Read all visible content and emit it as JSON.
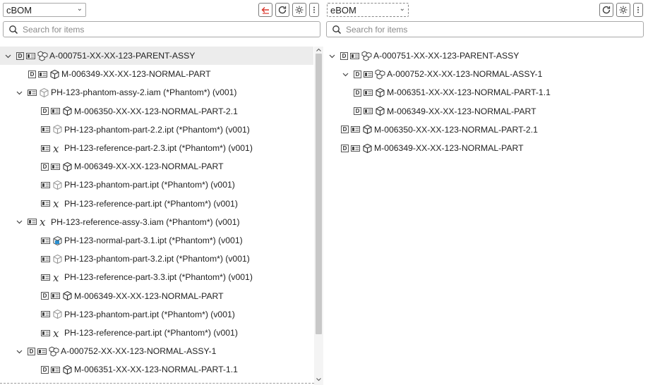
{
  "left": {
    "view_select": "cBOM",
    "search_placeholder": "Search for items",
    "toolbar": [
      "back-arrow-icon",
      "refresh-icon",
      "settings-icon",
      "more-icon"
    ],
    "rows": [
      {
        "label": "A-000751-XX-XX-123-PARENT-ASSY",
        "expanded": true,
        "d": true,
        "icon": "assembly",
        "selected": true
      },
      {
        "label": "M-006349-XX-XX-123-NORMAL-PART",
        "d": true,
        "icon": "part"
      },
      {
        "label": "PH-123-phantom-assy-2.iam (*Phantom*) (v001)",
        "expanded": true,
        "d": false,
        "icon": "phantom"
      },
      {
        "label": "M-006350-XX-XX-123-NORMAL-PART-2.1",
        "d": true,
        "icon": "part"
      },
      {
        "label": "PH-123-phantom-part-2.2.ipt (*Phantom*) (v001)",
        "d": false,
        "icon": "phantom"
      },
      {
        "label": "PH-123-reference-part-2.3.ipt (*Phantom*) (v001)",
        "d": false,
        "icon": "reference"
      },
      {
        "label": "M-006349-XX-XX-123-NORMAL-PART",
        "d": true,
        "icon": "part"
      },
      {
        "label": "PH-123-phantom-part.ipt (*Phantom*) (v001)",
        "d": false,
        "icon": "phantom"
      },
      {
        "label": "PH-123-reference-part.ipt (*Phantom*) (v001)",
        "d": false,
        "icon": "reference"
      },
      {
        "label": "PH-123-reference-assy-3.iam (*Phantom*) (v001)",
        "expanded": true,
        "d": false,
        "icon": "reference"
      },
      {
        "label": "PH-123-normal-part-3.1.ipt (*Phantom*) (v001)",
        "d": false,
        "icon": "normal-phantom"
      },
      {
        "label": "PH-123-phantom-part-3.2.ipt (*Phantom*) (v001)",
        "d": false,
        "icon": "phantom"
      },
      {
        "label": "PH-123-reference-part-3.3.ipt (*Phantom*) (v001)",
        "d": false,
        "icon": "reference"
      },
      {
        "label": "M-006349-XX-XX-123-NORMAL-PART",
        "d": true,
        "icon": "part"
      },
      {
        "label": "PH-123-phantom-part.ipt (*Phantom*) (v001)",
        "d": false,
        "icon": "phantom"
      },
      {
        "label": "PH-123-reference-part.ipt (*Phantom*) (v001)",
        "d": false,
        "icon": "reference"
      },
      {
        "label": "A-000752-XX-XX-123-NORMAL-ASSY-1",
        "expanded": true,
        "d": true,
        "icon": "assembly"
      },
      {
        "label": "M-006351-XX-XX-123-NORMAL-PART-1.1",
        "d": true,
        "icon": "part"
      }
    ]
  },
  "right": {
    "view_select": "eBOM",
    "search_placeholder": "Search for items",
    "toolbar": [
      "refresh-icon",
      "settings-icon",
      "more-icon"
    ],
    "rows": [
      {
        "label": "A-000751-XX-XX-123-PARENT-ASSY",
        "expanded": true,
        "d": true,
        "icon": "assembly"
      },
      {
        "label": "A-000752-XX-XX-123-NORMAL-ASSY-1",
        "expanded": true,
        "d": true,
        "icon": "assembly"
      },
      {
        "label": "M-006351-XX-XX-123-NORMAL-PART-1.1",
        "d": true,
        "icon": "part"
      },
      {
        "label": "M-006349-XX-XX-123-NORMAL-PART",
        "d": true,
        "icon": "part"
      },
      {
        "label": "M-006350-XX-XX-123-NORMAL-PART-2.1",
        "d": true,
        "icon": "part"
      },
      {
        "label": "M-006349-XX-XX-123-NORMAL-PART",
        "d": true,
        "icon": "part"
      }
    ]
  },
  "colors": {
    "accent_red": "#d9362b",
    "selected_row": "#ececec",
    "border": "#a9a9a9"
  }
}
